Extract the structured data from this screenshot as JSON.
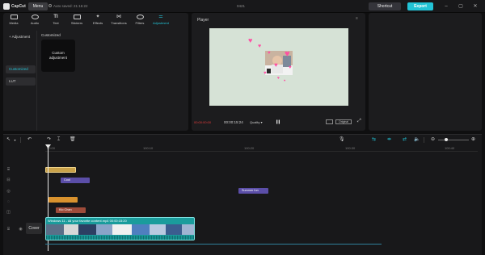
{
  "app": {
    "name": "CapCut",
    "menu_label": "Menu",
    "autosave": "Auto saved: 21:16:22",
    "project_name": "0421",
    "shortcut_label": "Shortcut",
    "export_label": "Export"
  },
  "toolbar": {
    "items": [
      {
        "label": "Media",
        "icon": "media-icon"
      },
      {
        "label": "Audio",
        "icon": "audio-icon"
      },
      {
        "label": "Text",
        "icon": "text-icon"
      },
      {
        "label": "Stickers",
        "icon": "sticker-icon"
      },
      {
        "label": "Effects",
        "icon": "effects-icon"
      },
      {
        "label": "Transitions",
        "icon": "transition-icon"
      },
      {
        "label": "Filters",
        "icon": "filter-icon"
      },
      {
        "label": "Adjustment",
        "icon": "adjustment-icon",
        "active": true
      }
    ]
  },
  "adjustment_panel": {
    "categories": [
      "+ Adjustment",
      "Customized",
      "LUT"
    ],
    "section_title": "Customized",
    "card_line1": "Custom",
    "card_line2": "adjustment"
  },
  "player": {
    "title": "Player",
    "timecode_current": "00:00:00:00",
    "timecode_total": "00:00:15:24",
    "quality_label": "Quality",
    "ratio_label": "Original"
  },
  "timeline": {
    "ticks": [
      "00:00",
      "100:10",
      "100:20",
      "100:30",
      "100:40"
    ],
    "clips": {
      "text_clip": "Cool",
      "sticker_clip": "Summer fun",
      "kio_clip": "Kio Chan"
    },
    "cover_label": "Cover",
    "video_clip": "Windows 11 - All your favorite content.mp4   00:00:15:20"
  },
  "colors": {
    "accent": "#22c3d6",
    "canvas_bg": "#d6e2d6",
    "video_clip": "#1a9c9c",
    "gold_clip": "#c9a24a",
    "purple_clip": "#5b4ea8",
    "orange_clip": "#d9922e",
    "brown_clip": "#9e4b3a"
  }
}
